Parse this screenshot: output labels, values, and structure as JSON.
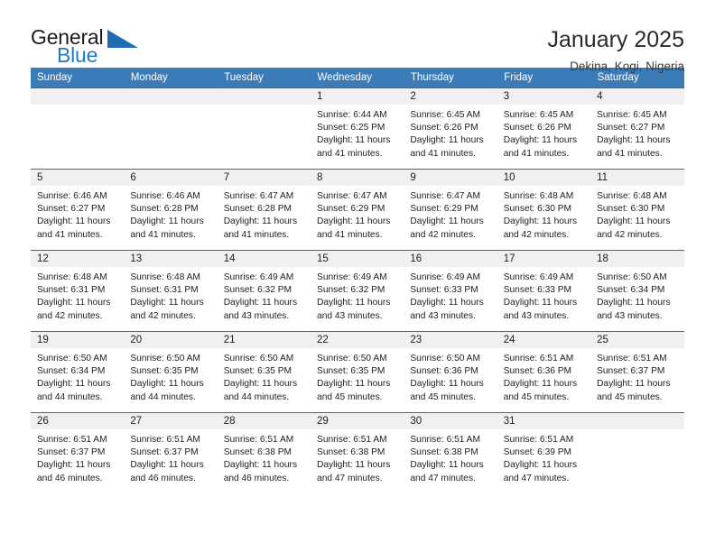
{
  "logo": {
    "word_top": "General",
    "word_bottom": "Blue",
    "triangle_color": "#1f6cb0",
    "blue_color": "#1f7ac4"
  },
  "header": {
    "title": "January 2025",
    "location": "Dekina, Kogi, Nigeria"
  },
  "theme": {
    "header_row_bg": "#3b7cb8",
    "week_border": "#2e6da4",
    "daynum_bg": "#f0f0f0"
  },
  "weekdays": [
    "Sunday",
    "Monday",
    "Tuesday",
    "Wednesday",
    "Thursday",
    "Friday",
    "Saturday"
  ],
  "labels": {
    "sunrise": "Sunrise:",
    "sunset": "Sunset:",
    "daylight": "Daylight:"
  },
  "weeks": [
    [
      {
        "day": "",
        "sunrise": "",
        "sunset": "",
        "daylight_line1": "",
        "daylight_line2": ""
      },
      {
        "day": "",
        "sunrise": "",
        "sunset": "",
        "daylight_line1": "",
        "daylight_line2": ""
      },
      {
        "day": "",
        "sunrise": "",
        "sunset": "",
        "daylight_line1": "",
        "daylight_line2": ""
      },
      {
        "day": "1",
        "sunrise": "Sunrise: 6:44 AM",
        "sunset": "Sunset: 6:25 PM",
        "daylight_line1": "Daylight: 11 hours",
        "daylight_line2": "and 41 minutes."
      },
      {
        "day": "2",
        "sunrise": "Sunrise: 6:45 AM",
        "sunset": "Sunset: 6:26 PM",
        "daylight_line1": "Daylight: 11 hours",
        "daylight_line2": "and 41 minutes."
      },
      {
        "day": "3",
        "sunrise": "Sunrise: 6:45 AM",
        "sunset": "Sunset: 6:26 PM",
        "daylight_line1": "Daylight: 11 hours",
        "daylight_line2": "and 41 minutes."
      },
      {
        "day": "4",
        "sunrise": "Sunrise: 6:45 AM",
        "sunset": "Sunset: 6:27 PM",
        "daylight_line1": "Daylight: 11 hours",
        "daylight_line2": "and 41 minutes."
      }
    ],
    [
      {
        "day": "5",
        "sunrise": "Sunrise: 6:46 AM",
        "sunset": "Sunset: 6:27 PM",
        "daylight_line1": "Daylight: 11 hours",
        "daylight_line2": "and 41 minutes."
      },
      {
        "day": "6",
        "sunrise": "Sunrise: 6:46 AM",
        "sunset": "Sunset: 6:28 PM",
        "daylight_line1": "Daylight: 11 hours",
        "daylight_line2": "and 41 minutes."
      },
      {
        "day": "7",
        "sunrise": "Sunrise: 6:47 AM",
        "sunset": "Sunset: 6:28 PM",
        "daylight_line1": "Daylight: 11 hours",
        "daylight_line2": "and 41 minutes."
      },
      {
        "day": "8",
        "sunrise": "Sunrise: 6:47 AM",
        "sunset": "Sunset: 6:29 PM",
        "daylight_line1": "Daylight: 11 hours",
        "daylight_line2": "and 41 minutes."
      },
      {
        "day": "9",
        "sunrise": "Sunrise: 6:47 AM",
        "sunset": "Sunset: 6:29 PM",
        "daylight_line1": "Daylight: 11 hours",
        "daylight_line2": "and 42 minutes."
      },
      {
        "day": "10",
        "sunrise": "Sunrise: 6:48 AM",
        "sunset": "Sunset: 6:30 PM",
        "daylight_line1": "Daylight: 11 hours",
        "daylight_line2": "and 42 minutes."
      },
      {
        "day": "11",
        "sunrise": "Sunrise: 6:48 AM",
        "sunset": "Sunset: 6:30 PM",
        "daylight_line1": "Daylight: 11 hours",
        "daylight_line2": "and 42 minutes."
      }
    ],
    [
      {
        "day": "12",
        "sunrise": "Sunrise: 6:48 AM",
        "sunset": "Sunset: 6:31 PM",
        "daylight_line1": "Daylight: 11 hours",
        "daylight_line2": "and 42 minutes."
      },
      {
        "day": "13",
        "sunrise": "Sunrise: 6:48 AM",
        "sunset": "Sunset: 6:31 PM",
        "daylight_line1": "Daylight: 11 hours",
        "daylight_line2": "and 42 minutes."
      },
      {
        "day": "14",
        "sunrise": "Sunrise: 6:49 AM",
        "sunset": "Sunset: 6:32 PM",
        "daylight_line1": "Daylight: 11 hours",
        "daylight_line2": "and 43 minutes."
      },
      {
        "day": "15",
        "sunrise": "Sunrise: 6:49 AM",
        "sunset": "Sunset: 6:32 PM",
        "daylight_line1": "Daylight: 11 hours",
        "daylight_line2": "and 43 minutes."
      },
      {
        "day": "16",
        "sunrise": "Sunrise: 6:49 AM",
        "sunset": "Sunset: 6:33 PM",
        "daylight_line1": "Daylight: 11 hours",
        "daylight_line2": "and 43 minutes."
      },
      {
        "day": "17",
        "sunrise": "Sunrise: 6:49 AM",
        "sunset": "Sunset: 6:33 PM",
        "daylight_line1": "Daylight: 11 hours",
        "daylight_line2": "and 43 minutes."
      },
      {
        "day": "18",
        "sunrise": "Sunrise: 6:50 AM",
        "sunset": "Sunset: 6:34 PM",
        "daylight_line1": "Daylight: 11 hours",
        "daylight_line2": "and 43 minutes."
      }
    ],
    [
      {
        "day": "19",
        "sunrise": "Sunrise: 6:50 AM",
        "sunset": "Sunset: 6:34 PM",
        "daylight_line1": "Daylight: 11 hours",
        "daylight_line2": "and 44 minutes."
      },
      {
        "day": "20",
        "sunrise": "Sunrise: 6:50 AM",
        "sunset": "Sunset: 6:35 PM",
        "daylight_line1": "Daylight: 11 hours",
        "daylight_line2": "and 44 minutes."
      },
      {
        "day": "21",
        "sunrise": "Sunrise: 6:50 AM",
        "sunset": "Sunset: 6:35 PM",
        "daylight_line1": "Daylight: 11 hours",
        "daylight_line2": "and 44 minutes."
      },
      {
        "day": "22",
        "sunrise": "Sunrise: 6:50 AM",
        "sunset": "Sunset: 6:35 PM",
        "daylight_line1": "Daylight: 11 hours",
        "daylight_line2": "and 45 minutes."
      },
      {
        "day": "23",
        "sunrise": "Sunrise: 6:50 AM",
        "sunset": "Sunset: 6:36 PM",
        "daylight_line1": "Daylight: 11 hours",
        "daylight_line2": "and 45 minutes."
      },
      {
        "day": "24",
        "sunrise": "Sunrise: 6:51 AM",
        "sunset": "Sunset: 6:36 PM",
        "daylight_line1": "Daylight: 11 hours",
        "daylight_line2": "and 45 minutes."
      },
      {
        "day": "25",
        "sunrise": "Sunrise: 6:51 AM",
        "sunset": "Sunset: 6:37 PM",
        "daylight_line1": "Daylight: 11 hours",
        "daylight_line2": "and 45 minutes."
      }
    ],
    [
      {
        "day": "26",
        "sunrise": "Sunrise: 6:51 AM",
        "sunset": "Sunset: 6:37 PM",
        "daylight_line1": "Daylight: 11 hours",
        "daylight_line2": "and 46 minutes."
      },
      {
        "day": "27",
        "sunrise": "Sunrise: 6:51 AM",
        "sunset": "Sunset: 6:37 PM",
        "daylight_line1": "Daylight: 11 hours",
        "daylight_line2": "and 46 minutes."
      },
      {
        "day": "28",
        "sunrise": "Sunrise: 6:51 AM",
        "sunset": "Sunset: 6:38 PM",
        "daylight_line1": "Daylight: 11 hours",
        "daylight_line2": "and 46 minutes."
      },
      {
        "day": "29",
        "sunrise": "Sunrise: 6:51 AM",
        "sunset": "Sunset: 6:38 PM",
        "daylight_line1": "Daylight: 11 hours",
        "daylight_line2": "and 47 minutes."
      },
      {
        "day": "30",
        "sunrise": "Sunrise: 6:51 AM",
        "sunset": "Sunset: 6:38 PM",
        "daylight_line1": "Daylight: 11 hours",
        "daylight_line2": "and 47 minutes."
      },
      {
        "day": "31",
        "sunrise": "Sunrise: 6:51 AM",
        "sunset": "Sunset: 6:39 PM",
        "daylight_line1": "Daylight: 11 hours",
        "daylight_line2": "and 47 minutes."
      },
      {
        "day": "",
        "sunrise": "",
        "sunset": "",
        "daylight_line1": "",
        "daylight_line2": ""
      }
    ]
  ]
}
